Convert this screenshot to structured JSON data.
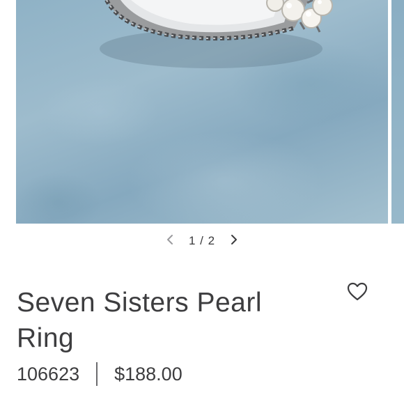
{
  "gallery": {
    "current": "1",
    "separator": "/",
    "total": "2",
    "counter_text": "1 / 2"
  },
  "product": {
    "title": "Seven Sisters Pearl Ring",
    "sku": "106623",
    "price": "$188.00"
  },
  "icons": {
    "prev": "chevron-left-icon",
    "next": "chevron-right-icon",
    "wishlist": "heart-outline-icon"
  },
  "colors": {
    "text": "#3d3d3f",
    "background_blue": "#8fb2c6"
  }
}
